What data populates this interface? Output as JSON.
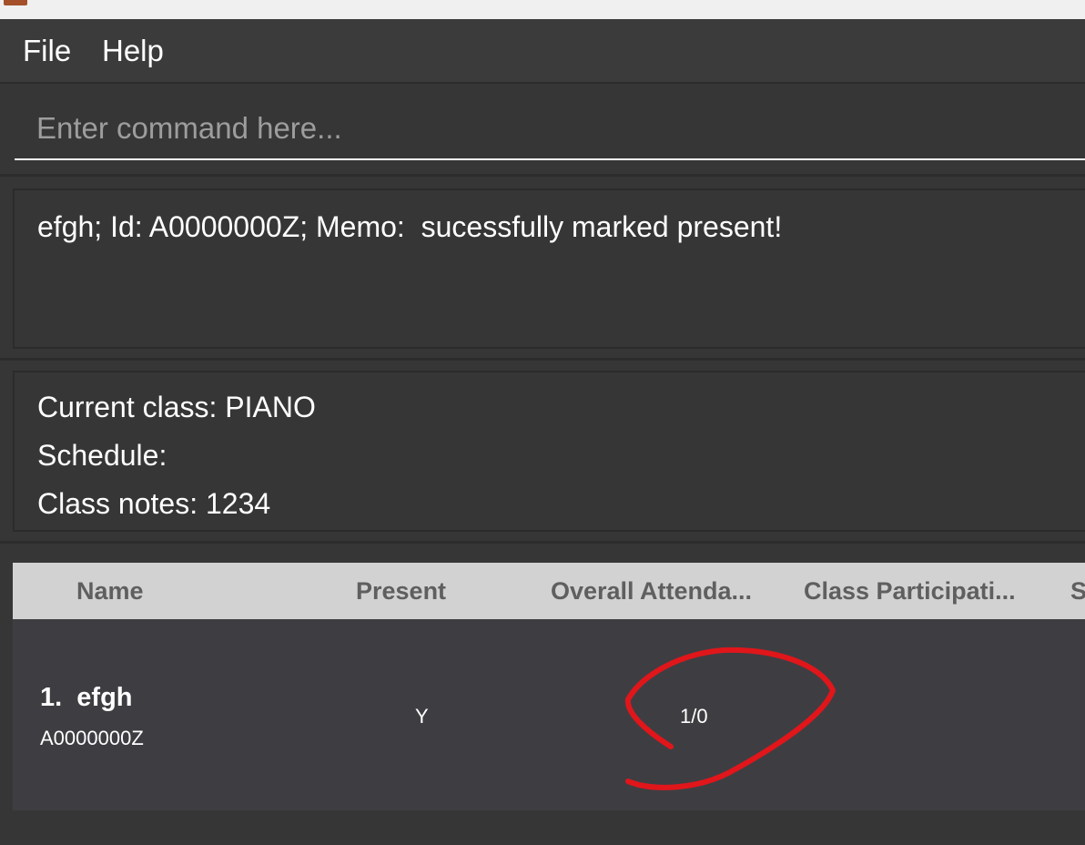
{
  "menu": {
    "file_label": "File",
    "help_label": "Help"
  },
  "command": {
    "placeholder": "Enter command here..."
  },
  "result": {
    "text": "efgh; Id: A0000000Z; Memo:  sucessfully marked present!"
  },
  "class_info": {
    "current_class": "Current class: PIANO",
    "schedule": "Schedule:",
    "notes": "Class notes: 1234"
  },
  "table": {
    "columns": [
      "Name",
      "Present",
      "Overall Attenda...",
      "Class Participati...",
      "S"
    ],
    "rows": [
      {
        "name": "1.  efgh",
        "id": "A0000000Z",
        "present": "Y",
        "attendance": "1/0"
      }
    ]
  },
  "colors": {
    "background": "#363636",
    "header_bg": "#d2d2d2",
    "annotation": "#e0161b"
  },
  "icons": {
    "app": "app-icon"
  }
}
